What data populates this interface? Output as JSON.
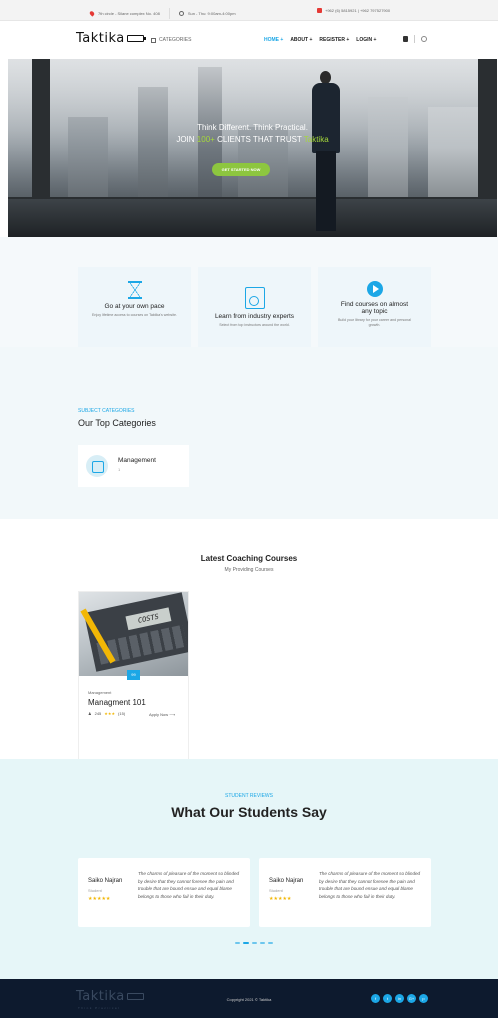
{
  "topbar": {
    "address": "7th circle - Silane complex No. 408",
    "hours": "Sun - Thu: 9:00am-4:00pm",
    "phones": "+962 (6) 5815921 | +962 797527900"
  },
  "header": {
    "logo": "Taktika",
    "categories_label": "CATEGORIES",
    "nav": [
      "HOME +",
      "ABOUT +",
      "REGISTER +",
      "LOGIN +"
    ]
  },
  "hero": {
    "line1": "Think Different. Think Practical.",
    "line2_pre": "JOIN",
    "line2_num": "100+",
    "line2_mid": "CLIENTS THAT TRUST",
    "line2_brand": "Taktika",
    "cta": "GET STARTED NOW"
  },
  "features": [
    {
      "title": "Go at your own pace",
      "desc": "Enjoy lifetime access to courses on Taktika's website.",
      "icon": "hourglass-icon"
    },
    {
      "title": "Learn from industry experts",
      "desc": "Select from top instructors around the world.",
      "icon": "report-chart-icon"
    },
    {
      "title": "Find courses on almost any topic",
      "desc": "Build your library for your career and personal growth.",
      "icon": "play-icon"
    }
  ],
  "categories": {
    "subtitle": "SUBJECT CATEGORIES",
    "title": "Our Top Categories",
    "items": [
      {
        "name": "Management",
        "count": "1"
      }
    ]
  },
  "courses": {
    "title": "Latest Coaching Courses",
    "subtitle": "My Providing Courses",
    "items": [
      {
        "image_text": "COSTS",
        "badge": "99",
        "category": "Management",
        "name": "Managment 101",
        "students": "245",
        "rating": "(15)",
        "apply": "Apply Now"
      }
    ]
  },
  "reviews": {
    "subtitle": "STUDENT REVIEWS",
    "title": "What Our Students Say",
    "items": [
      {
        "name": "Saiko Najran",
        "role": "Student",
        "stars": "★★★★★",
        "quote": "The charms of pleasure of the moment so blinded by desire that they cannot foresee the pain and trouble that are bound ensue and equal blame belongs to those who fail in their duty."
      },
      {
        "name": "Saiko Najran",
        "role": "Student",
        "stars": "★★★★★",
        "quote": "The charms of pleasure of the moment so blinded by desire that they cannot foresee the pain and trouble that are bound ensue and equal blame belongs to those who fail in their duty."
      }
    ]
  },
  "footer": {
    "logo": "Taktika",
    "tagline": "Think Practical",
    "copyright": "Copyright 2021 © Taktika",
    "socials": [
      "f",
      "t",
      "in",
      "G+",
      "p"
    ]
  },
  "colors": {
    "accent": "#1ca7e6",
    "green": "#8dc63f",
    "footer": "#0d1a2e"
  }
}
